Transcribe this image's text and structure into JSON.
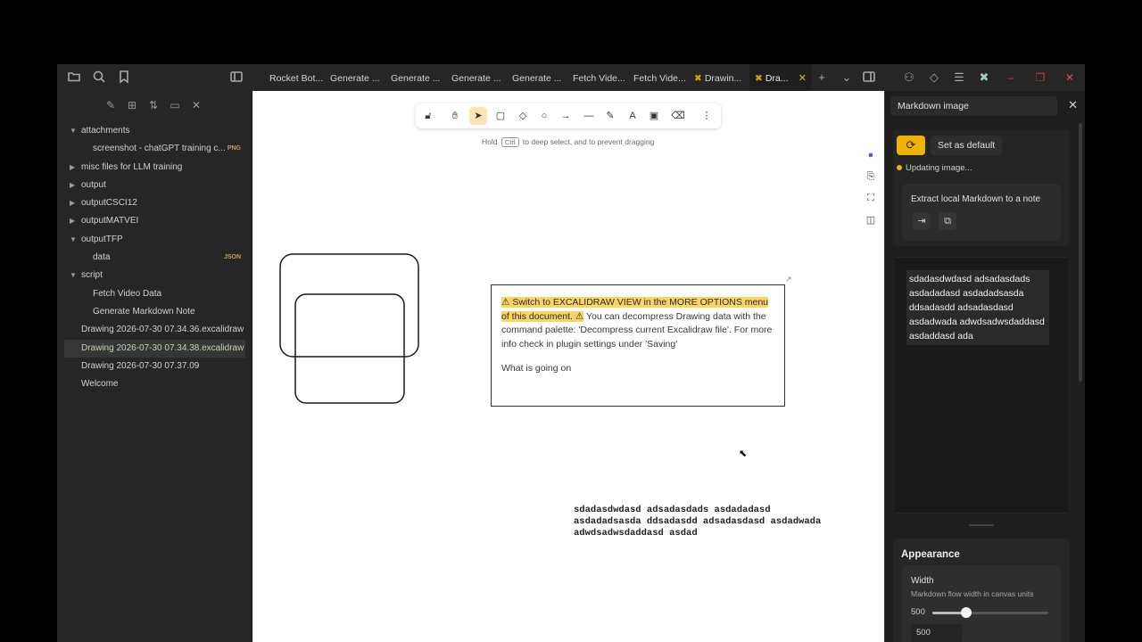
{
  "tabs": [
    {
      "label": "Rocket Bot..."
    },
    {
      "label": "Generate ..."
    },
    {
      "label": "Generate ..."
    },
    {
      "label": "Generate ..."
    },
    {
      "label": "Generate ..."
    },
    {
      "label": "Fetch Vide..."
    },
    {
      "label": "Fetch Vide..."
    },
    {
      "label": "Drawin..."
    },
    {
      "label": "Dra..."
    }
  ],
  "tree": [
    {
      "label": "attachments",
      "level": 0,
      "expanded": true
    },
    {
      "label": "screenshot - chatGPT training c...",
      "level": 1,
      "tag": "PNG"
    },
    {
      "label": "misc files for LLM training",
      "level": 0,
      "expanded": false
    },
    {
      "label": "output",
      "level": 0,
      "expanded": false
    },
    {
      "label": "outputCSCI12",
      "level": 0,
      "expanded": false
    },
    {
      "label": "outputMATVEI",
      "level": 0,
      "expanded": false
    },
    {
      "label": "outputTFP",
      "level": 0,
      "expanded": true
    },
    {
      "label": "data",
      "level": 1,
      "tag": "JSON"
    },
    {
      "label": "script",
      "level": 0,
      "expanded": true
    },
    {
      "label": "Fetch Video Data",
      "level": 1
    },
    {
      "label": "Generate Markdown Note",
      "level": 1
    },
    {
      "label": "Drawing 2026-07-30 07.34.36.excalidraw",
      "level": 0
    },
    {
      "label": "Drawing 2026-07-30 07.34.38.excalidraw",
      "level": 0,
      "selected": true
    },
    {
      "label": "Drawing 2026-07-30 07.37.09",
      "level": 0
    },
    {
      "label": "Welcome",
      "level": 0
    }
  ],
  "canvas": {
    "hint_pre": "Hold",
    "hint_key": "Ctrl",
    "hint_post": "to deep select, and to prevent dragging",
    "note_highlight_1": "⚠ Switch to EXCALIDRAW VIEW in the MORE OPTIONS menu of this document. ⚠",
    "note_rest_1": " You can decompress Drawing data with the command palette: 'Decompress current Excalidraw file'. For more info check in plugin settings under 'Saving'",
    "note_p2": "What is going on",
    "mono_text": "sdadasdwdasd adsadasdads asdadadasd asdadadsasda ddsadasdd adsadasdasd asdadwada adwdsadwsdaddasd asdad"
  },
  "panel": {
    "search_value": "Markdown image",
    "set_default": "Set as default",
    "updating": "Updating image...",
    "extract_title": "Extract local Markdown to a note",
    "preview_text": "sdadasdwdasd adsadasdads asdadadasd asdadadsasda ddsadasdd adsadasdasd asdadwada adwdsadwsdaddasd asdaddasd ada",
    "appearance_heading": "Appearance",
    "width_title": "Width",
    "width_desc": "Markdown flow width in canvas units",
    "width_value": "500",
    "width_input": "500",
    "width_slider_fraction": 0.29
  },
  "colors": {
    "accent": "#f0b400",
    "highlight": "#fbd462",
    "close_red": "#e05050"
  }
}
